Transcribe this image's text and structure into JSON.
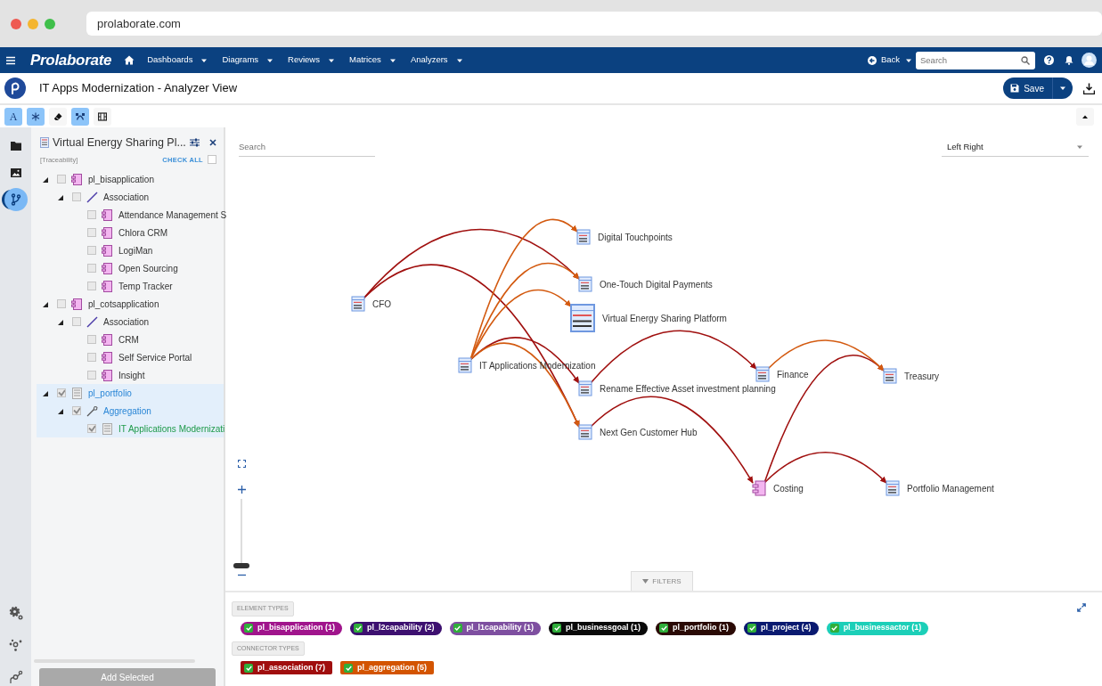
{
  "browser": {
    "address": "prolaborate.com"
  },
  "navbar": {
    "brand": "Prolaborate",
    "menus": [
      {
        "label": "Dashboards"
      },
      {
        "label": "Diagrams"
      },
      {
        "label": "Reviews"
      },
      {
        "label": "Matrices"
      },
      {
        "label": "Analyzers"
      }
    ],
    "back": "Back",
    "search": {
      "placeholder": "Search"
    }
  },
  "page": {
    "title": "IT Apps Modernization - Analyzer View",
    "save": "Save"
  },
  "toolbar": [
    {
      "kind": "letter",
      "label": "A",
      "selected": true
    },
    {
      "kind": "asterisk",
      "selected": true
    },
    {
      "kind": "eraser",
      "selected": false
    },
    {
      "kind": "curve",
      "selected": true
    },
    {
      "kind": "film",
      "selected": false
    }
  ],
  "rail": {
    "top": [
      {
        "kind": "folder",
        "selected": false
      },
      {
        "kind": "image",
        "selected": false
      },
      {
        "kind": "branch",
        "selected": true
      }
    ],
    "bottom": [
      {
        "kind": "gear"
      },
      {
        "kind": "network"
      },
      {
        "kind": "path"
      }
    ]
  },
  "tree_panel": {
    "title": "Virtual Energy Sharing Pl...",
    "subtitle": "[Traceability]",
    "check_all": {
      "label": "CHECK ALL",
      "checked": false
    },
    "items": [
      {
        "label": "pl_bisapplication",
        "kind": "component",
        "checked": false,
        "selected": false,
        "expanded": true,
        "children": [
          {
            "label": "Association",
            "kind": "association",
            "checked": false,
            "selected": false,
            "expanded": true,
            "children": [
              {
                "label": "Attendance Management S",
                "kind": "component",
                "checked": false,
                "selected": false
              },
              {
                "label": "Chlora CRM",
                "kind": "component",
                "checked": false,
                "selected": false
              },
              {
                "label": "LogiMan",
                "kind": "component",
                "checked": false,
                "selected": false
              },
              {
                "label": "Open Sourcing",
                "kind": "component",
                "checked": false,
                "selected": false
              },
              {
                "label": "Temp Tracker",
                "kind": "component",
                "checked": false,
                "selected": false
              }
            ]
          }
        ]
      },
      {
        "label": "pl_cotsapplication",
        "kind": "component",
        "checked": false,
        "selected": false,
        "expanded": true,
        "children": [
          {
            "label": "Association",
            "kind": "association",
            "checked": false,
            "selected": false,
            "expanded": true,
            "children": [
              {
                "label": "CRM",
                "kind": "component",
                "checked": false,
                "selected": false
              },
              {
                "label": "Self Service Portal",
                "kind": "component",
                "checked": false,
                "selected": false
              },
              {
                "label": "Insight",
                "kind": "component",
                "checked": false,
                "selected": false
              }
            ]
          }
        ]
      },
      {
        "label": "pl_portfolio",
        "kind": "artifact",
        "checked": true,
        "selected": true,
        "expanded": true,
        "children": [
          {
            "label": "Aggregation",
            "kind": "aggregation",
            "checked": true,
            "selected": true,
            "expanded": true,
            "children": [
              {
                "label": "IT Applications Modernizati",
                "kind": "artifact",
                "checked": true,
                "selected": true
              }
            ]
          }
        ]
      }
    ],
    "add_button": "Add Selected"
  },
  "diagram": {
    "search": {
      "placeholder": "Search"
    },
    "layout": "Left Right",
    "zoom": {
      "level": 0
    },
    "nodes": [
      {
        "label": "CFO",
        "kind": "list",
        "focus": false
      },
      {
        "label": "Digital Touchpoints",
        "kind": "list",
        "focus": false
      },
      {
        "label": "One-Touch Digital Payments",
        "kind": "list",
        "focus": false
      },
      {
        "label": "Virtual Energy Sharing Platform",
        "kind": "list",
        "focus": true
      },
      {
        "label": "IT Applications Modernization",
        "kind": "list",
        "focus": false
      },
      {
        "label": "Rename Effective Asset investment planning",
        "kind": "list",
        "focus": false
      },
      {
        "label": "Next Gen Customer Hub",
        "kind": "list",
        "focus": false
      },
      {
        "label": "Finance",
        "kind": "list",
        "focus": false
      },
      {
        "label": "Treasury",
        "kind": "list",
        "focus": false
      },
      {
        "label": "Costing",
        "kind": "component",
        "focus": false
      },
      {
        "label": "Portfolio Management",
        "kind": "list",
        "focus": false
      }
    ],
    "edges": [
      {
        "kind": "association"
      },
      {
        "kind": "association"
      },
      {
        "kind": "association"
      },
      {
        "kind": "association"
      },
      {
        "kind": "association"
      },
      {
        "kind": "association"
      },
      {
        "kind": "association"
      },
      {
        "kind": "aggregation"
      },
      {
        "kind": "aggregation"
      },
      {
        "kind": "aggregation"
      },
      {
        "kind": "aggregation"
      },
      {
        "kind": "aggregation"
      }
    ]
  },
  "filters": {
    "tab": "FILTERS",
    "groups": [
      {
        "title": "ELEMENT TYPES",
        "items": [
          {
            "label": "pl_bisapplication (1)",
            "color": "#a0148c",
            "checked": true
          },
          {
            "label": "pl_l2capability (2)",
            "color": "#3d1070",
            "checked": true
          },
          {
            "label": "pl_l1capability (1)",
            "color": "#7e4fa0",
            "checked": true
          },
          {
            "label": "pl_businessgoal (1)",
            "color": "#0a0a0a",
            "checked": true
          },
          {
            "label": "pl_portfolio (1)",
            "color": "#2a0a05",
            "checked": true
          },
          {
            "label": "pl_project (4)",
            "color": "#0a1a70",
            "checked": true
          },
          {
            "label": "pl_businessactor (1)",
            "color": "#1ccfb8",
            "checked": true
          }
        ]
      },
      {
        "title": "CONNECTOR TYPES",
        "items": [
          {
            "label": "pl_association (7)",
            "color": "#a00e0e",
            "checked": true
          },
          {
            "label": "pl_aggregation (5)",
            "color": "#d35400",
            "checked": true
          }
        ]
      }
    ]
  }
}
